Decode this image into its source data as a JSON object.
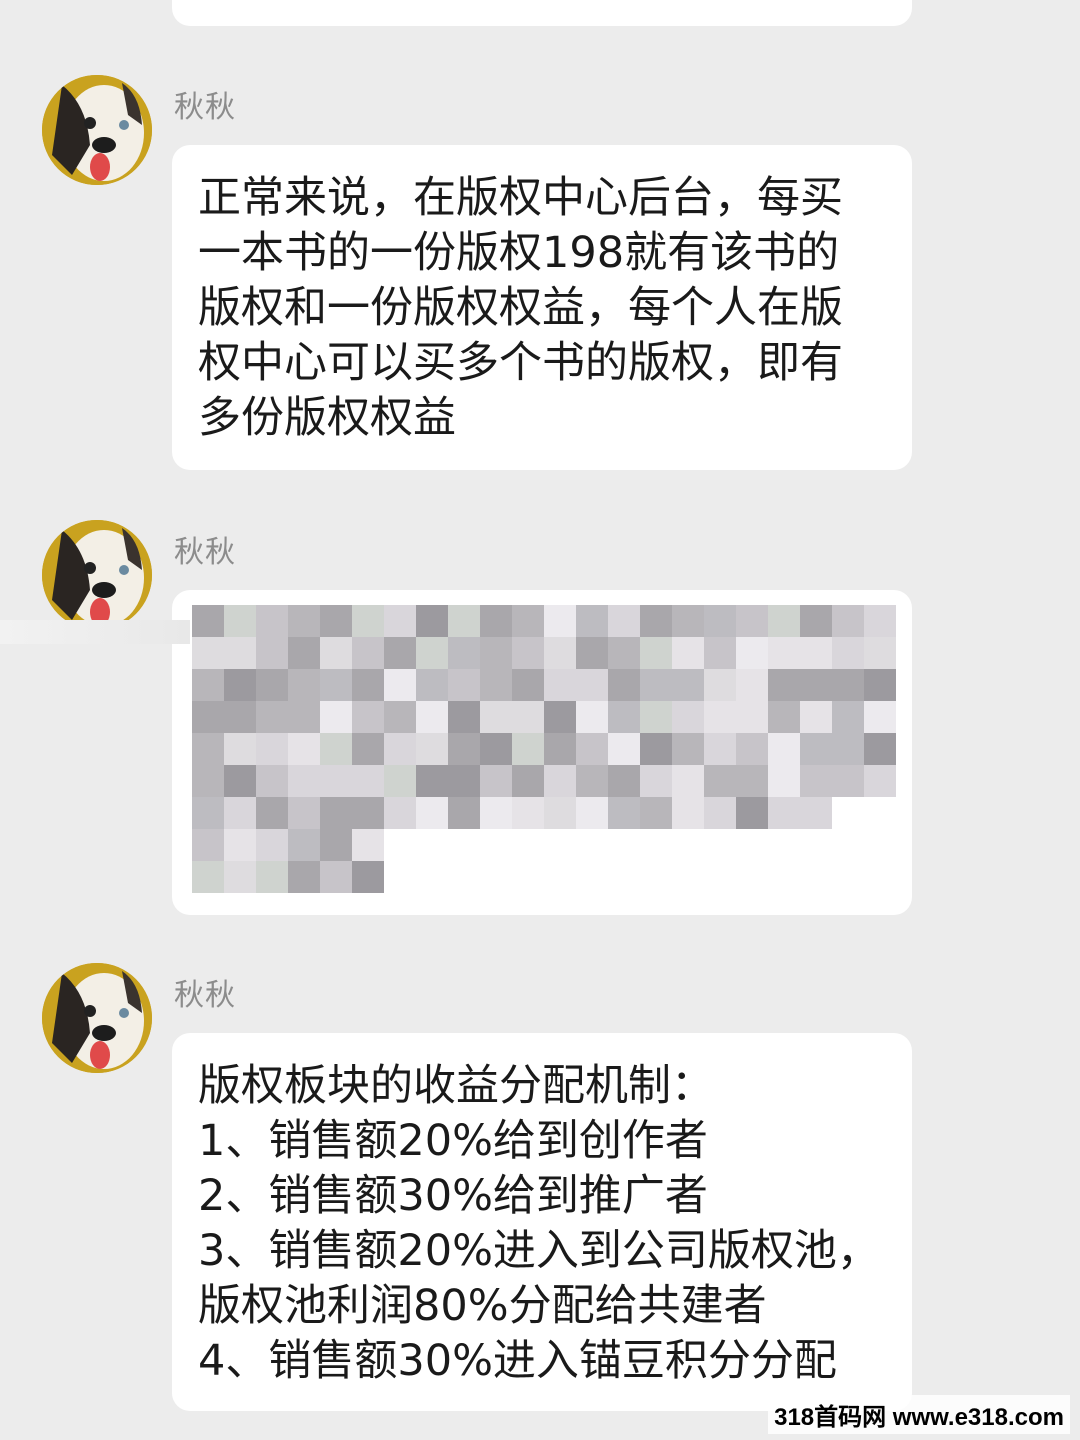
{
  "messages": [
    {
      "sender": "秋秋",
      "lines": [
        "正常来说，在版权中心后台，每买",
        "一本书的一份版权198就有该书的",
        "版权和一份版权权益，每个人在版",
        "权中心可以买多个书的版权，即有",
        "多份版权权益"
      ]
    },
    {
      "sender": "秋秋",
      "content": "blurred"
    },
    {
      "sender": "秋秋",
      "lines": [
        "版权板块的收益分配机制：",
        "1、销售额20%给到创作者",
        "2、销售额30%给到推广者",
        "3、销售额20%进入到公司版权池，",
        "版权池利润80%分配给共建者",
        "4、销售额30%进入锚豆积分分配"
      ]
    }
  ],
  "watermark": "318首码网 www.e318.com",
  "colors": {
    "background": "#ececec",
    "bubble": "#ffffff",
    "sender_name": "#8c8c8c",
    "avatar_ring": "#c9a21f"
  },
  "icons": [
    "avatar-dog"
  ]
}
